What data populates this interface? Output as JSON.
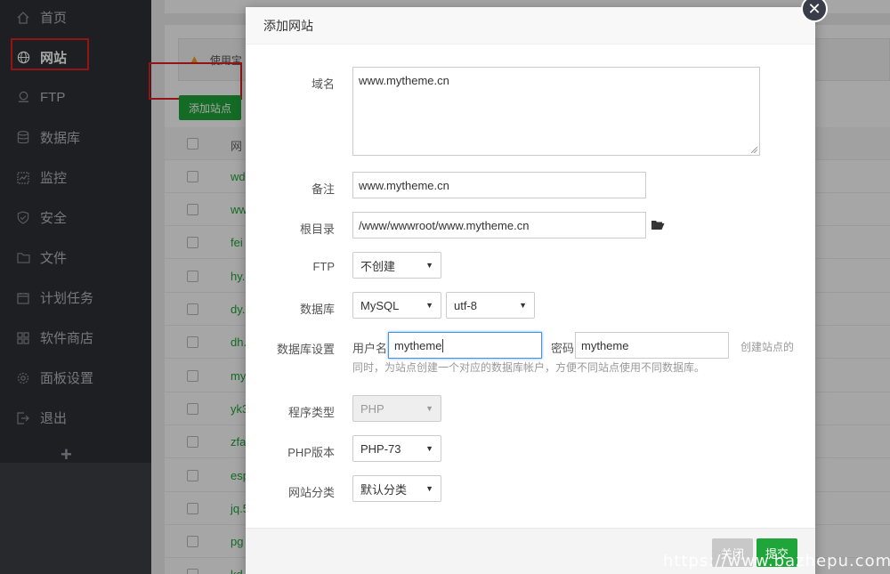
{
  "sidebar": {
    "items": [
      {
        "label": "首页",
        "icon": "home-icon"
      },
      {
        "label": "网站",
        "icon": "globe-icon"
      },
      {
        "label": "FTP",
        "icon": "ftp-icon"
      },
      {
        "label": "数据库",
        "icon": "database-icon"
      },
      {
        "label": "监控",
        "icon": "monitor-icon"
      },
      {
        "label": "安全",
        "icon": "shield-icon"
      },
      {
        "label": "文件",
        "icon": "folder-icon"
      },
      {
        "label": "计划任务",
        "icon": "calendar-icon"
      },
      {
        "label": "软件商店",
        "icon": "grid-icon"
      },
      {
        "label": "面板设置",
        "icon": "gear-icon"
      },
      {
        "label": "退出",
        "icon": "logout-icon"
      }
    ],
    "add_label": "+"
  },
  "main": {
    "warning_text": "使用宝",
    "add_site_label": "添加站点",
    "table_header": "网",
    "rows": [
      "wd",
      "ww",
      "fei",
      "hy.",
      "dy.",
      "dh.",
      "my",
      "yk3",
      "zfa",
      "esp",
      "jq.5",
      "pg",
      "kd"
    ]
  },
  "modal": {
    "title": "添加网站",
    "domain_label": "域名",
    "domain_value": "www.mytheme.cn",
    "remark_label": "备注",
    "remark_value": "www.mytheme.cn",
    "root_label": "根目录",
    "root_value": "/www/wwwroot/www.mytheme.cn",
    "ftp_label": "FTP",
    "ftp_value": "不创建",
    "db_label": "数据库",
    "db_type": "MySQL",
    "db_charset": "utf-8",
    "db_settings_label": "数据库设置",
    "db_user_label": "用户名",
    "db_user_value": "mytheme",
    "db_pass_label": "密码",
    "db_pass_value": "mytheme",
    "db_hint_1": "创建站点的",
    "db_hint_2": "同时，为站点创建一个对应的数据库帐户，方便不同站点使用不同数据库。",
    "program_label": "程序类型",
    "program_value": "PHP",
    "php_label": "PHP版本",
    "php_value": "PHP-73",
    "category_label": "网站分类",
    "category_value": "默认分类",
    "close_label": "关闭",
    "submit_label": "提交"
  },
  "watermark": "https://www.bazhepu.com",
  "colors": {
    "accent": "#20a53a",
    "sidebar": "#2f3136",
    "highlight": "#e02020"
  }
}
